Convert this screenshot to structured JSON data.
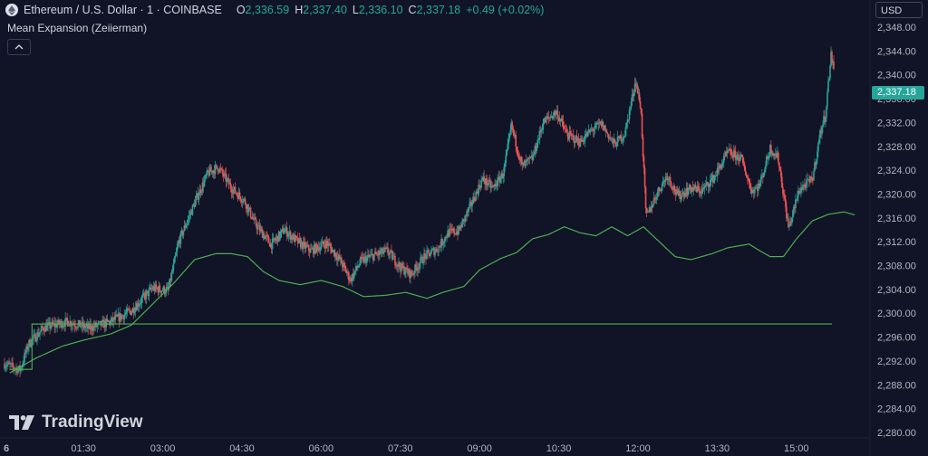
{
  "header": {
    "symbol": "Ethereum / U.S. Dollar · 1 · COINBASE",
    "o_key": "O",
    "o_val": "2,336.59",
    "h_key": "H",
    "h_val": "2,337.40",
    "l_key": "L",
    "l_val": "2,336.10",
    "c_key": "C",
    "c_val": "2,337.18",
    "change": "+0.49 (+0.02%)"
  },
  "indicator": {
    "title": "Mean Expansion (Zeiierman)"
  },
  "currency": "USD",
  "last_price": "2,337.18",
  "logo": {
    "text": "TradingView"
  },
  "colors": {
    "background": "#111327",
    "up": "#26a69a",
    "down": "#ef5350",
    "indicator_line": "#4caf50",
    "badge": "#26a69a"
  },
  "icons": [
    "ethereum-icon",
    "chevron-up-icon",
    "tradingview-logo-icon"
  ],
  "chart_data": {
    "type": "candlestick",
    "title": "Ethereum / U.S. Dollar · 1 · COINBASE",
    "y_ticks": [
      "2,348.00",
      "2,344.00",
      "2,340.00",
      "2,336.00",
      "2,332.00",
      "2,328.00",
      "2,324.00",
      "2,320.00",
      "2,316.00",
      "2,312.00",
      "2,308.00",
      "2,304.00",
      "2,300.00",
      "2,296.00",
      "2,292.00",
      "2,288.00",
      "2,284.00",
      "2,280.00"
    ],
    "ylim": [
      2278,
      2350
    ],
    "x_ticks": [
      "6",
      "01:30",
      "03:00",
      "04:30",
      "06:00",
      "07:30",
      "09:00",
      "10:30",
      "12:00",
      "13:30",
      "15:00"
    ],
    "x_tick_hours": [
      0,
      1.5,
      3,
      4.5,
      6,
      7.5,
      9,
      10.5,
      12,
      13.5,
      15
    ],
    "xlim_hours": [
      0,
      16.1
    ],
    "close_anchors": [
      [
        0,
        2291.5
      ],
      [
        0.3,
        2290.5
      ],
      [
        0.45,
        2294.8
      ],
      [
        0.75,
        2297.6
      ],
      [
        1.2,
        2298.6
      ],
      [
        1.6,
        2297.5
      ],
      [
        2.0,
        2298.5
      ],
      [
        2.4,
        2300.4
      ],
      [
        2.8,
        2304.2
      ],
      [
        3.1,
        2303.8
      ],
      [
        3.3,
        2312
      ],
      [
        3.6,
        2318.5
      ],
      [
        3.85,
        2323.5
      ],
      [
        4.05,
        2324.5
      ],
      [
        4.3,
        2321
      ],
      [
        4.55,
        2318.8
      ],
      [
        4.75,
        2315
      ],
      [
        5.05,
        2311.5
      ],
      [
        5.3,
        2314
      ],
      [
        5.55,
        2312
      ],
      [
        5.8,
        2310.5
      ],
      [
        6.1,
        2311.8
      ],
      [
        6.35,
        2309
      ],
      [
        6.55,
        2305.6
      ],
      [
        6.75,
        2308.8
      ],
      [
        7.0,
        2309.7
      ],
      [
        7.25,
        2310.5
      ],
      [
        7.5,
        2307.7
      ],
      [
        7.7,
        2306.5
      ],
      [
        7.95,
        2309.5
      ],
      [
        8.2,
        2310.8
      ],
      [
        8.4,
        2313.5
      ],
      [
        8.6,
        2313.8
      ],
      [
        8.8,
        2317.5
      ],
      [
        9.05,
        2322.5
      ],
      [
        9.25,
        2321
      ],
      [
        9.45,
        2323.5
      ],
      [
        9.6,
        2331.5
      ],
      [
        9.8,
        2324.6
      ],
      [
        10.0,
        2326
      ],
      [
        10.2,
        2332
      ],
      [
        10.45,
        2333.8
      ],
      [
        10.65,
        2330
      ],
      [
        10.9,
        2328.7
      ],
      [
        11.1,
        2330.6
      ],
      [
        11.3,
        2331.8
      ],
      [
        11.55,
        2328.3
      ],
      [
        11.75,
        2330.2
      ],
      [
        11.95,
        2339
      ],
      [
        12.05,
        2334.5
      ],
      [
        12.15,
        2316
      ],
      [
        12.35,
        2320
      ],
      [
        12.55,
        2323.2
      ],
      [
        12.75,
        2319.6
      ],
      [
        13.0,
        2321
      ],
      [
        13.2,
        2320.5
      ],
      [
        13.45,
        2323
      ],
      [
        13.7,
        2327
      ],
      [
        13.95,
        2326
      ],
      [
        14.15,
        2320.5
      ],
      [
        14.3,
        2321.5
      ],
      [
        14.5,
        2327.7
      ],
      [
        14.65,
        2326.1
      ],
      [
        14.85,
        2314.2
      ],
      [
        15.05,
        2320.7
      ],
      [
        15.3,
        2322.5
      ],
      [
        15.45,
        2330.3
      ],
      [
        15.55,
        2333.5
      ],
      [
        15.65,
        2343.3
      ],
      [
        15.75,
        2339
      ],
      [
        15.9,
        2336
      ],
      [
        16.1,
        2337.2
      ]
    ],
    "mean_expansion_anchors": [
      [
        0.1,
        2290
      ],
      [
        0.6,
        2292.5
      ],
      [
        1.1,
        2294.5
      ],
      [
        1.5,
        2295.5
      ],
      [
        2.0,
        2296.5
      ],
      [
        2.4,
        2298
      ],
      [
        2.8,
        2301.5
      ],
      [
        3.2,
        2305
      ],
      [
        3.6,
        2309
      ],
      [
        4.0,
        2310
      ],
      [
        4.3,
        2310
      ],
      [
        4.6,
        2309.5
      ],
      [
        4.9,
        2307
      ],
      [
        5.2,
        2305.5
      ],
      [
        5.6,
        2304.8
      ],
      [
        6.0,
        2305.5
      ],
      [
        6.4,
        2304.5
      ],
      [
        6.8,
        2302.8
      ],
      [
        7.2,
        2303
      ],
      [
        7.6,
        2303.5
      ],
      [
        8.0,
        2302.5
      ],
      [
        8.3,
        2303.5
      ],
      [
        8.7,
        2304.5
      ],
      [
        9.0,
        2307.3
      ],
      [
        9.4,
        2309.2
      ],
      [
        9.7,
        2310.2
      ],
      [
        10.0,
        2312.5
      ],
      [
        10.3,
        2313.2
      ],
      [
        10.6,
        2314.5
      ],
      [
        10.9,
        2313.5
      ],
      [
        11.2,
        2313
      ],
      [
        11.5,
        2314.5
      ],
      [
        11.8,
        2313
      ],
      [
        12.1,
        2314.5
      ],
      [
        12.4,
        2312
      ],
      [
        12.7,
        2309.5
      ],
      [
        13.0,
        2309
      ],
      [
        13.4,
        2310
      ],
      [
        13.7,
        2311
      ],
      [
        14.1,
        2311.6
      ],
      [
        14.3,
        2310.5
      ],
      [
        14.5,
        2309.5
      ],
      [
        14.75,
        2309.5
      ],
      [
        15.0,
        2312.5
      ],
      [
        15.3,
        2315.5
      ],
      [
        15.6,
        2316.6
      ],
      [
        15.9,
        2317
      ],
      [
        16.1,
        2316.5
      ]
    ],
    "flat_level": {
      "value": 2298.2,
      "start_hour": 0.52,
      "step_path": [
        [
          0.1,
          2290.6
        ],
        [
          0.52,
          2290.6
        ],
        [
          0.52,
          2298.2
        ],
        [
          1.2,
          2298.2
        ]
      ]
    }
  }
}
